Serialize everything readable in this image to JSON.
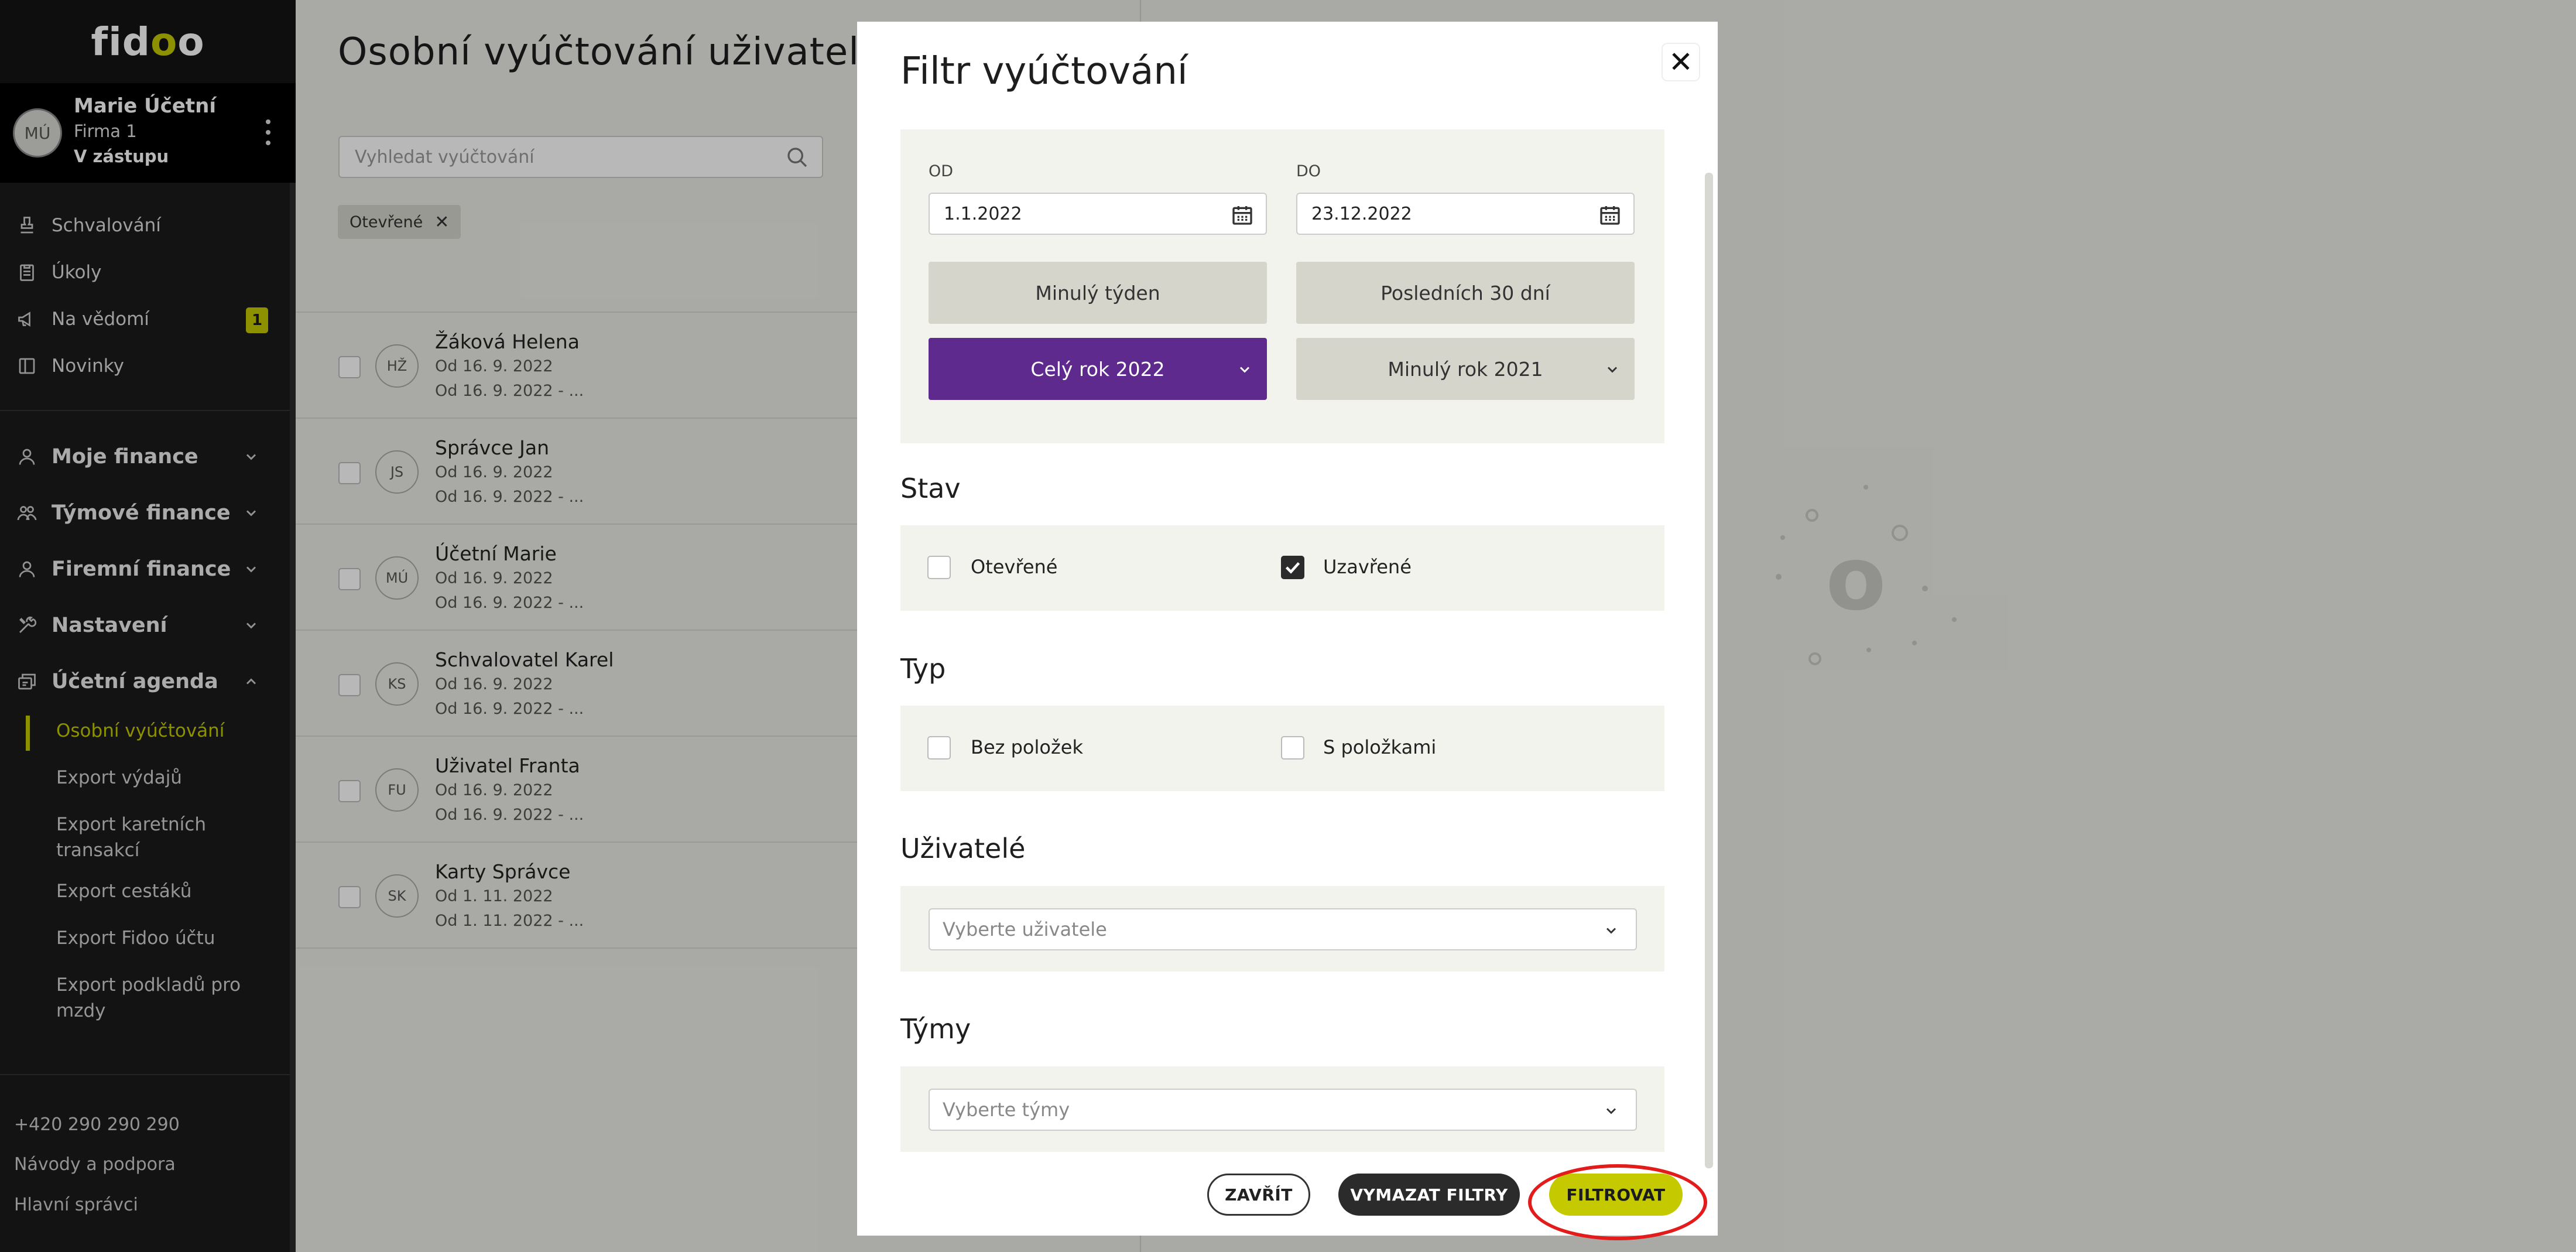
{
  "colors": {
    "accent": "#c4c900",
    "selected": "#5f2a8e",
    "sidebar_bg": "#1b1b1b",
    "highlight": "#e31b1b"
  },
  "sidebar": {
    "logo": {
      "part1": "fid",
      "part2": "o",
      "part3": "o"
    },
    "user": {
      "initials": "MÚ",
      "name": "Marie Účetní",
      "firm": "Firma 1",
      "deputy": "V zástupu",
      "menu_icon": "kebab-icon"
    },
    "quick": [
      {
        "label": "Schvalování",
        "icon": "stamp-icon"
      },
      {
        "label": "Úkoly",
        "icon": "clipboard-icon"
      },
      {
        "label": "Na vědomí",
        "icon": "megaphone-icon",
        "badge": "1"
      },
      {
        "label": "Novinky",
        "icon": "book-icon"
      }
    ],
    "groups": [
      {
        "label": "Moje finance",
        "icon": "person-icon",
        "state": "collapsed"
      },
      {
        "label": "Týmové finance",
        "icon": "team-icon",
        "state": "collapsed"
      },
      {
        "label": "Firemní finance",
        "icon": "person-icon",
        "state": "collapsed"
      },
      {
        "label": "Nastavení",
        "icon": "tools-icon",
        "state": "collapsed"
      },
      {
        "label": "Účetní agenda",
        "icon": "accounting-icon",
        "state": "expanded"
      }
    ],
    "sub": [
      {
        "label": "Osobní vyúčtování",
        "active": true
      },
      {
        "label": "Export výdajů"
      },
      {
        "label": "Export karetních transakcí"
      },
      {
        "label": "Export cestáků"
      },
      {
        "label": "Export Fidoo účtu"
      },
      {
        "label": "Export podkladů pro mzdy"
      }
    ],
    "footer": [
      "+420 290 290 290",
      "Návody a podpora",
      "Hlavní správci"
    ]
  },
  "main": {
    "title": "Osobní vyúčtování uživatelů",
    "search_placeholder": "Vyhledat vyúčtování",
    "filter_chip": "Otevřené",
    "rows": [
      {
        "initials": "HŽ",
        "name": "Žáková Helena",
        "line1": "Od 16. 9. 2022",
        "line2": "Od 16. 9. 2022 - ..."
      },
      {
        "initials": "JS",
        "name": "Správce Jan",
        "line1": "Od 16. 9. 2022",
        "line2": "Od 16. 9. 2022 - ..."
      },
      {
        "initials": "MÚ",
        "name": "Účetní Marie",
        "line1": "Od 16. 9. 2022",
        "line2": "Od 16. 9. 2022 - ..."
      },
      {
        "initials": "KS",
        "name": "Schvalovatel Karel",
        "line1": "Od 16. 9. 2022",
        "line2": "Od 16. 9. 2022 - ..."
      },
      {
        "initials": "FU",
        "name": "Uživatel Franta",
        "line1": "Od 16. 9. 2022",
        "line2": "Od 16. 9. 2022 - ..."
      },
      {
        "initials": "SK",
        "name": "Karty Správce",
        "line1": "Od 1. 11. 2022",
        "line2": "Od 1. 11. 2022 - ..."
      }
    ]
  },
  "modal": {
    "title": "Filtr vyúčtování",
    "close_icon": "close-icon",
    "date": {
      "from_label": "OD",
      "from_value": "1.1.2022",
      "to_label": "DO",
      "to_value": "23.12.2022",
      "quick": [
        "Minulý týden",
        "Posledních 30 dní"
      ],
      "year_selected": "Celý rok 2022",
      "year_other": "Minulý rok 2021"
    },
    "stav": {
      "title": "Stav",
      "options": [
        {
          "label": "Otevřené",
          "checked": false
        },
        {
          "label": "Uzavřené",
          "checked": true
        }
      ]
    },
    "typ": {
      "title": "Typ",
      "options": [
        {
          "label": "Bez položek",
          "checked": false
        },
        {
          "label": "S položkami",
          "checked": false
        }
      ]
    },
    "users": {
      "title": "Uživatelé",
      "placeholder": "Vyberte uživatele"
    },
    "teams": {
      "title": "Týmy",
      "placeholder": "Vyberte týmy"
    },
    "buttons": {
      "close": "ZAVŘÍT",
      "clear": "VYMAZAT FILTRY",
      "filter": "FILTROVAT"
    }
  }
}
